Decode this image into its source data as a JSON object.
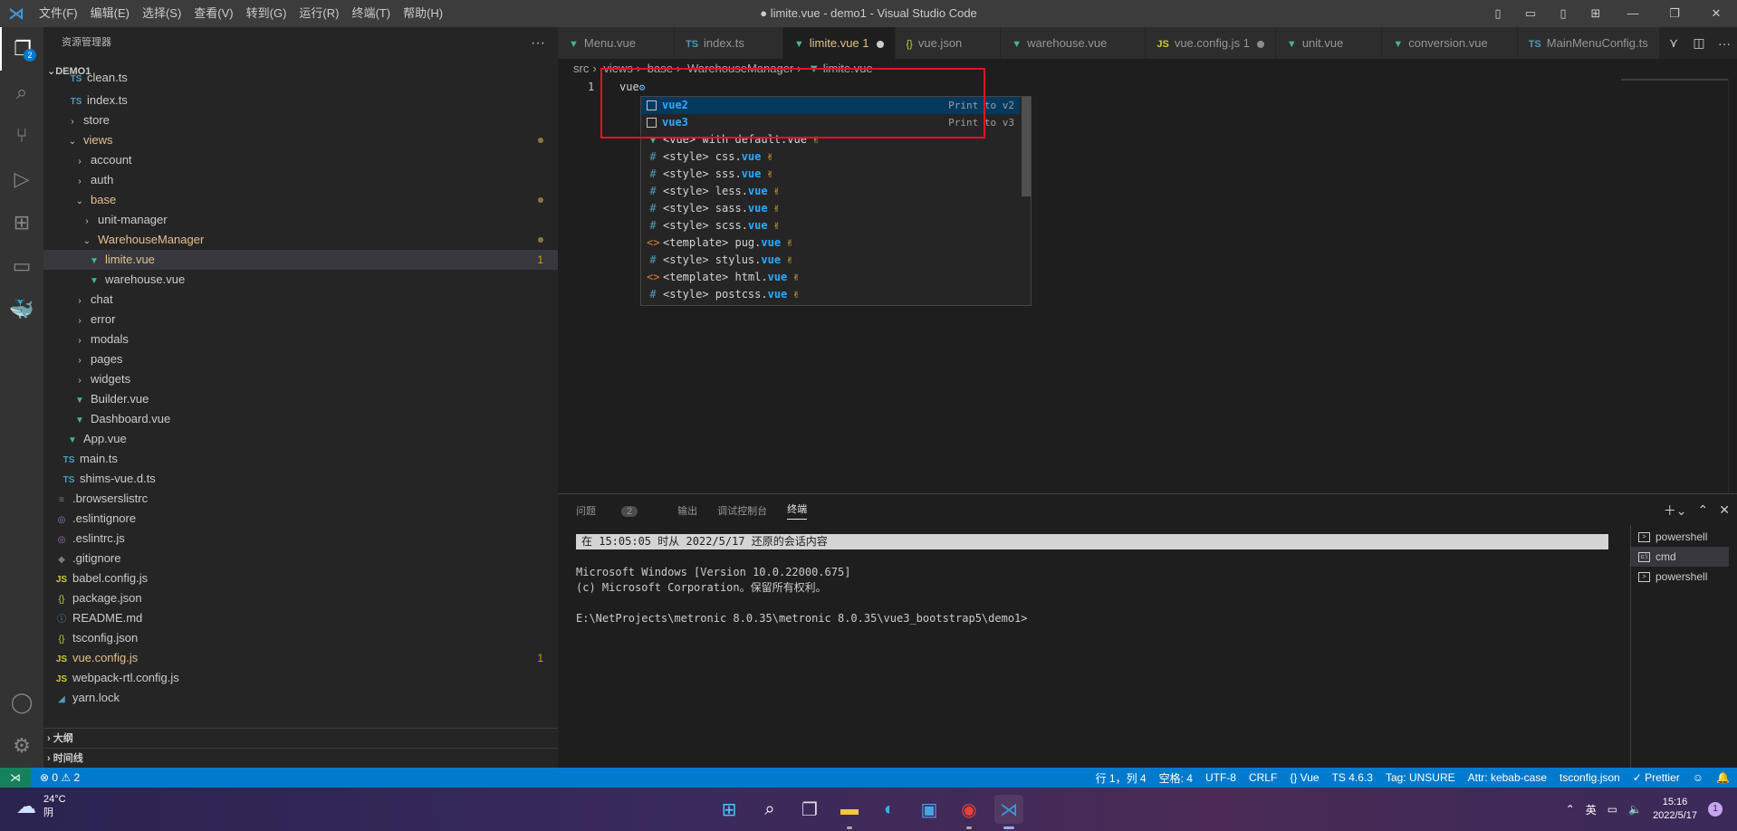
{
  "window": {
    "title": "● limite.vue - demo1 - Visual Studio Code",
    "menu": [
      "文件(F)",
      "编辑(E)",
      "选择(S)",
      "查看(V)",
      "转到(G)",
      "运行(R)",
      "终端(T)",
      "帮助(H)"
    ],
    "controls": {
      "minimize": "—",
      "maximize": "❐",
      "close": "✕"
    }
  },
  "activity": {
    "scm_badge": "2",
    "account_badge": ""
  },
  "sidebar": {
    "header": "资源管理器",
    "more": "···",
    "project": "DEMO1",
    "items": [
      {
        "label": "clean.ts",
        "icon": "TS"
      },
      {
        "label": "index.ts",
        "icon": "TS"
      },
      {
        "label": "store",
        "icon": "›"
      },
      {
        "label": "views",
        "icon": "⌄"
      },
      {
        "label": "account",
        "icon": "›"
      },
      {
        "label": "auth",
        "icon": "›"
      },
      {
        "label": "base",
        "icon": "⌄"
      },
      {
        "label": "unit-manager",
        "icon": "›"
      },
      {
        "label": "WarehouseManager",
        "icon": "⌄"
      },
      {
        "label": "limite.vue",
        "icon": "▼",
        "count": "1"
      },
      {
        "label": "warehouse.vue",
        "icon": "▼"
      },
      {
        "label": "chat",
        "icon": "›"
      },
      {
        "label": "error",
        "icon": "›"
      },
      {
        "label": "modals",
        "icon": "›"
      },
      {
        "label": "pages",
        "icon": "›"
      },
      {
        "label": "widgets",
        "icon": "›"
      },
      {
        "label": "Builder.vue",
        "icon": "▼"
      },
      {
        "label": "Dashboard.vue",
        "icon": "▼"
      },
      {
        "label": "App.vue",
        "icon": "▼"
      },
      {
        "label": "main.ts",
        "icon": "TS"
      },
      {
        "label": "shims-vue.d.ts",
        "icon": "TS"
      },
      {
        "label": ".browserslistrc",
        "icon": "≡"
      },
      {
        "label": ".eslintignore",
        "icon": "◎"
      },
      {
        "label": ".eslintrc.js",
        "icon": "◎"
      },
      {
        "label": ".gitignore",
        "icon": "◆"
      },
      {
        "label": "babel.config.js",
        "icon": "JS"
      },
      {
        "label": "package.json",
        "icon": "{}"
      },
      {
        "label": "README.md",
        "icon": "ⓘ"
      },
      {
        "label": "tsconfig.json",
        "icon": "{}"
      },
      {
        "label": "vue.config.js",
        "icon": "JS",
        "count": "1"
      },
      {
        "label": "webpack-rtl.config.js",
        "icon": "JS"
      },
      {
        "label": "yarn.lock",
        "icon": "🧶"
      }
    ],
    "outline": "大纲",
    "timeline": "时间线"
  },
  "tabs": [
    {
      "label": "Menu.vue",
      "icon": "▼"
    },
    {
      "label": "index.ts",
      "icon": "TS"
    },
    {
      "label": "limite.vue 1",
      "icon": "▼"
    },
    {
      "label": "vue.json",
      "icon": "{}"
    },
    {
      "label": "warehouse.vue",
      "icon": "▼"
    },
    {
      "label": "vue.config.js 1",
      "icon": "JS"
    },
    {
      "label": "unit.vue",
      "icon": "▼"
    },
    {
      "label": "conversion.vue",
      "icon": "▼"
    },
    {
      "label": "MainMenuConfig.ts",
      "icon": "TS"
    }
  ],
  "breadcrumb": [
    "src",
    "views",
    "base",
    "WarehouseManager",
    "limite.vue"
  ],
  "editor": {
    "line_number": "1",
    "code": "vue"
  },
  "suggest": [
    {
      "icon": "□",
      "pre": "",
      "hl": "vue2",
      "post": "",
      "detail": "Print to v2"
    },
    {
      "icon": "□",
      "pre": "",
      "hl": "vue3",
      "post": "",
      "detail": "Print to v3"
    },
    {
      "icon": "▼",
      "pre": "<vue> with default.vue",
      "hl": "",
      "post": "",
      "detail": ""
    },
    {
      "icon": "#",
      "pre": "<style> css.",
      "hl": "vue",
      "post": "",
      "detail": ""
    },
    {
      "icon": "#",
      "pre": "<style> sss.",
      "hl": "vue",
      "post": "",
      "detail": ""
    },
    {
      "icon": "#",
      "pre": "<style> less.",
      "hl": "vue",
      "post": "",
      "detail": ""
    },
    {
      "icon": "#",
      "pre": "<style> sass.",
      "hl": "vue",
      "post": "",
      "detail": ""
    },
    {
      "icon": "#",
      "pre": "<style> scss.",
      "hl": "vue",
      "post": "",
      "detail": ""
    },
    {
      "icon": "<>",
      "pre": "<template> pug.",
      "hl": "vue",
      "post": "",
      "detail": ""
    },
    {
      "icon": "#",
      "pre": "<style> stylus.",
      "hl": "vue",
      "post": "",
      "detail": ""
    },
    {
      "icon": "<>",
      "pre": "<template> html.",
      "hl": "vue",
      "post": "",
      "detail": ""
    },
    {
      "icon": "#",
      "pre": "<style> postcss.",
      "hl": "vue",
      "post": "",
      "detail": ""
    }
  ],
  "panel": {
    "tabs": [
      "问题",
      "输出",
      "调试控制台",
      "终端"
    ],
    "problems_count": "2",
    "terminal_lines": [
      "在 15:05:05 时从 2022/5/17 还原的会话内容",
      "",
      "Microsoft Windows [Version 10.0.22000.675]",
      "(c) Microsoft Corporation。保留所有权利。",
      "",
      "E:\\NetProjects\\metronic 8.0.35\\metronic 8.0.35\\vue3_bootstrap5\\demo1>"
    ],
    "terminals": [
      "powershell",
      "cmd",
      "powershell"
    ]
  },
  "status": {
    "errors": "⊗ 0 ⚠ 2",
    "position": "行 1，列 4",
    "spaces": "空格: 4",
    "encoding": "UTF-8",
    "eol": "CRLF",
    "language": "{} Vue",
    "ts": "TS 4.6.3",
    "tag": "Tag: UNSURE",
    "attr": "Attr: kebab-case",
    "tsconfig": "tsconfig.json",
    "prettier": "✓ Prettier"
  },
  "taskbar": {
    "weather_temp": "24°C",
    "weather_desc": "阴",
    "ime": "英",
    "time": "15:16",
    "date": "2022/5/17",
    "notif": "1"
  },
  "colors": {
    "accent": "#007acc",
    "modified": "#e2c08d",
    "vue": "#41b883",
    "highlight": "#e81123"
  }
}
